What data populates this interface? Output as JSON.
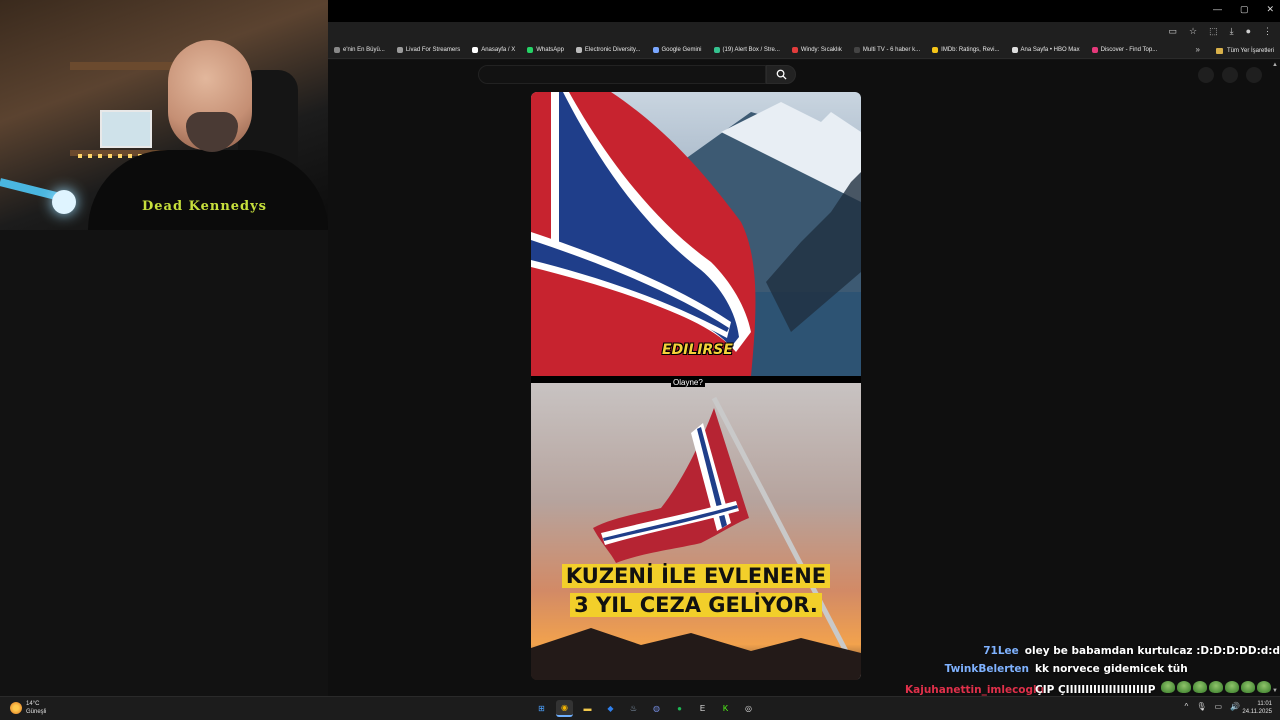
{
  "browser": {
    "window_controls": [
      "—",
      "▢",
      "✕"
    ],
    "toolbar_icons": [
      "cast-icon",
      "star-icon",
      "extensions-icon",
      "download-icon",
      "profile-icon",
      "menu-icon"
    ],
    "bookmarks": [
      {
        "label": "e'nin En Büyü...",
        "color": "#888888"
      },
      {
        "label": "Livad For Streamers",
        "color": "#9b9b9b"
      },
      {
        "label": "Anasayfa / X",
        "color": "#ffffff"
      },
      {
        "label": "WhatsApp",
        "color": "#25d366"
      },
      {
        "label": "Electronic Diversity...",
        "color": "#bbbbbb"
      },
      {
        "label": "Google Gemini",
        "color": "#7aa7ff"
      },
      {
        "label": "(19) Alert Box / Stre...",
        "color": "#35c28f"
      },
      {
        "label": "Windy: Sıcaklık",
        "color": "#e23c3c"
      },
      {
        "label": "Multi TV - 6 haber k...",
        "color": "#444444"
      },
      {
        "label": "IMDb: Ratings, Revi...",
        "color": "#f5c518"
      },
      {
        "label": "Ana Sayfa • HBO Max",
        "color": "#dddddd"
      },
      {
        "label": "Discover - Find Top...",
        "color": "#e5397a"
      }
    ],
    "bookmarks_more": "»",
    "all_bookmarks": "Tüm Yer İşaretleri"
  },
  "page": {
    "search_placeholder": "",
    "video": {
      "caption_top": "EDILIRSE",
      "caption_middle": "Olayne?",
      "caption_bottom_line1": "KUZENİ İLE EVLENENE",
      "caption_bottom_line2": "3 YIL CEZA GELİYOR."
    }
  },
  "webcam": {
    "shirt_text": "Dead Kennedys"
  },
  "chat": [
    {
      "user": "71Lee",
      "color": "#7fb2ff",
      "message": "oley be babamdan kurtulcaz :D:D:D:DD:d:d",
      "emotes": 0
    },
    {
      "user": "TwinkBelerten",
      "color": "#7fb2ff",
      "message": "kk norvece gidemicek tüh",
      "emotes": 0
    },
    {
      "user": "Kajuhanettin_imlecoglu",
      "color": "#e0304a",
      "message": "ÇIP ÇIIIIIIIIIIIIIIIIIIIIIP",
      "emotes": 7
    },
    {
      "user": "",
      "color": "#ffffff",
      "message": "",
      "emotes": 3
    }
  ],
  "taskbar": {
    "weather_temp": "14°C",
    "weather_desc": "Güneşli",
    "apps": [
      {
        "name": "start-icon",
        "glyph": "⊞",
        "color": "#4da3ff"
      },
      {
        "name": "chrome-icon",
        "glyph": "◉",
        "color": "#f4b400"
      },
      {
        "name": "folder-icon",
        "glyph": "▬",
        "color": "#f2c94c"
      },
      {
        "name": "app-blue-icon",
        "glyph": "◆",
        "color": "#2f80ed"
      },
      {
        "name": "steam-icon",
        "glyph": "♨",
        "color": "#9fb8d6"
      },
      {
        "name": "discord-icon",
        "glyph": "◍",
        "color": "#7289da"
      },
      {
        "name": "spotify-icon",
        "glyph": "●",
        "color": "#1db954"
      },
      {
        "name": "epic-icon",
        "glyph": "E",
        "color": "#dddddd"
      },
      {
        "name": "kick-icon",
        "glyph": "K",
        "color": "#53fc18"
      },
      {
        "name": "obs-icon",
        "glyph": "◎",
        "color": "#dddddd"
      }
    ],
    "tray_icons": [
      "^",
      "🎙",
      "▭",
      "🔊"
    ],
    "time": "11:01",
    "date": "24.11.2025"
  }
}
